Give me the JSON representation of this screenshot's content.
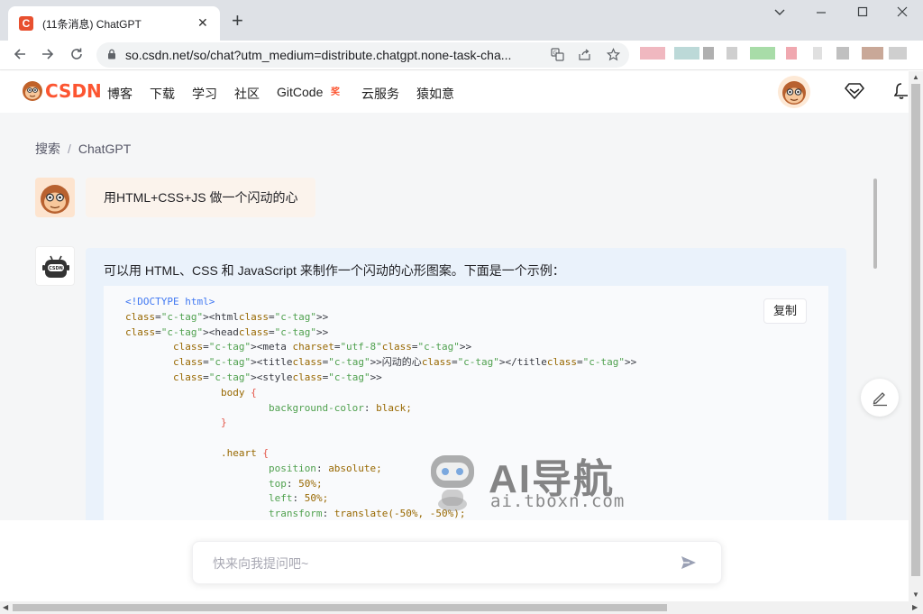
{
  "browser": {
    "tab_title": "(11条消息) ChatGPT",
    "tab_favicon": "C",
    "url": "so.csdn.net/so/chat?utm_medium=distribute.chatgpt.none-task-cha...",
    "icons": [
      "back-icon",
      "forward-icon",
      "reload-icon",
      "lock-icon",
      "translate-icon",
      "share-icon",
      "star-icon",
      "minimize-icon",
      "maximize-icon",
      "close-icon",
      "new-tab-icon"
    ]
  },
  "site": {
    "logo_text": "CSDN",
    "brand_color": "#fc5531",
    "nav": [
      "博客",
      "下载",
      "学习",
      "社区",
      "GitCode",
      "云服务",
      "猿如意"
    ],
    "gitcode_badge": "奖"
  },
  "breadcrumb": {
    "root": "搜索",
    "separator": "/",
    "current": "ChatGPT"
  },
  "chat": {
    "user_message": "用HTML+CSS+JS 做一个闪动的心",
    "bot_intro": "可以用 HTML、CSS 和 JavaScript 来制作一个闪动的心形图案。下面是一个示例：",
    "copy_label": "复制",
    "code_lines": [
      "<!DOCTYPE html>",
      "<html>",
      "<head>",
      "        <meta charset=\"utf-8\">",
      "        <title>闪动的心</title>",
      "        <style>",
      "                body {",
      "                        background-color: black;",
      "                }",
      "",
      "                .heart {",
      "                        position: absolute;",
      "                        top: 50%;",
      "                        left: 50%;",
      "                        transform: translate(-50%, -50%);"
    ]
  },
  "composer": {
    "placeholder": "快来向我提问吧~"
  },
  "watermark": {
    "title": "AI导航",
    "subtitle": "ai.tboxn.com"
  }
}
